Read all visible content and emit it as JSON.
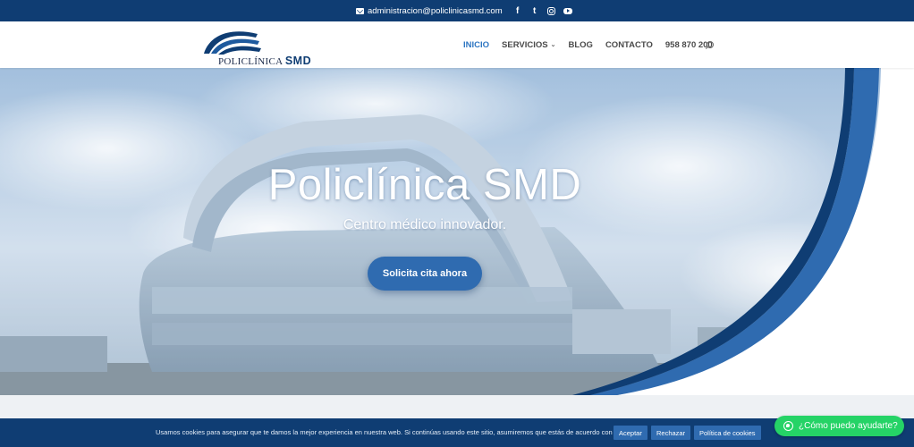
{
  "topbar": {
    "email": "administracion@policlinicasmd.com",
    "social": [
      "facebook-icon",
      "twitter-icon",
      "instagram-icon",
      "youtube-icon"
    ],
    "facebook_glyph": "f",
    "twitter_glyph": "t"
  },
  "header": {
    "logo_text_main": "POLICLÍNICA",
    "logo_text_brand": "SMD",
    "nav": {
      "inicio": "INICIO",
      "servicios": "SERVICIOS",
      "servicios_chevron": "⌄",
      "blog": "BLOG",
      "contacto": "CONTACTO",
      "phone": "958 870 200"
    }
  },
  "hero": {
    "title": "Policlínica SMD",
    "subtitle": "Centro médico innovador.",
    "cta": "Solicita cita ahora"
  },
  "cookie_bar": {
    "text": "Usamos cookies para asegurar que te damos la mejor experiencia en nuestra web. Si continúas usando este sitio, asumiremos que estás de acuerdo con ello.",
    "accept": "Aceptar",
    "reject": "Rechazar",
    "policy": "Política de cookies"
  },
  "whatsapp": {
    "label": "¿Cómo puedo ayudarte?"
  },
  "colors": {
    "primary": "#0f3d73",
    "accent": "#2e76c2",
    "button": "#2f6bb0",
    "whatsapp": "#25d366"
  }
}
